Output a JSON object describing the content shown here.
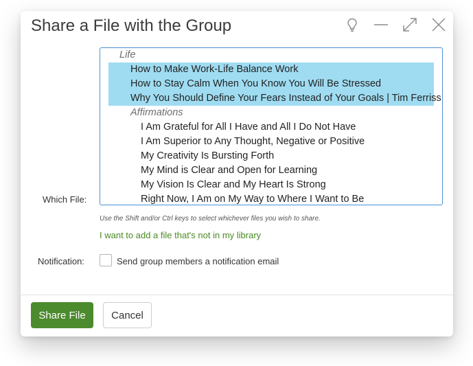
{
  "dialog": {
    "title": "Share a File with the Group",
    "icons": [
      "lightbulb-icon",
      "minimize-icon",
      "expand-icon",
      "close-icon"
    ]
  },
  "form": {
    "which_file_label": "Which File:",
    "files": {
      "group_life": "Life",
      "life_items": [
        "How to Make Work-Life Balance Work",
        "How to Stay Calm When You Know You Will Be Stressed",
        "Why You Should Define Your Fears Instead of Your Goals | Tim Ferriss"
      ],
      "group_affirmations": "Affirmations",
      "affirmation_items": [
        "I Am Grateful for All I Have and All I Do Not Have",
        "I Am Superior to Any Thought, Negative or Positive",
        "My Creativity Is Bursting Forth",
        "My Mind is Clear and Open for Learning",
        "My Vision Is Clear and My Heart Is Strong",
        "Right Now, I Am on My Way to Where I Want to Be"
      ],
      "selected": [
        "How to Make Work-Life Balance Work",
        "How to Stay Calm When You Know You Will Be Stressed",
        "Why You Should Define Your Fears Instead of Your Goals | Tim Ferriss"
      ]
    },
    "hint": "Use the Shift and/or Ctrl keys to select whichever files you wish to share.",
    "add_file_link": "I want to add a file that's not in my library",
    "notification_label": "Notification:",
    "notification_checkbox_label": "Send group members a notification email",
    "notification_checked": false
  },
  "buttons": {
    "share": "Share File",
    "cancel": "Cancel"
  },
  "colors": {
    "selection": "#9fdcf2",
    "primary_button": "#4c8a2e",
    "link": "#4a8a23",
    "listbox_border": "#4c8fd6"
  }
}
